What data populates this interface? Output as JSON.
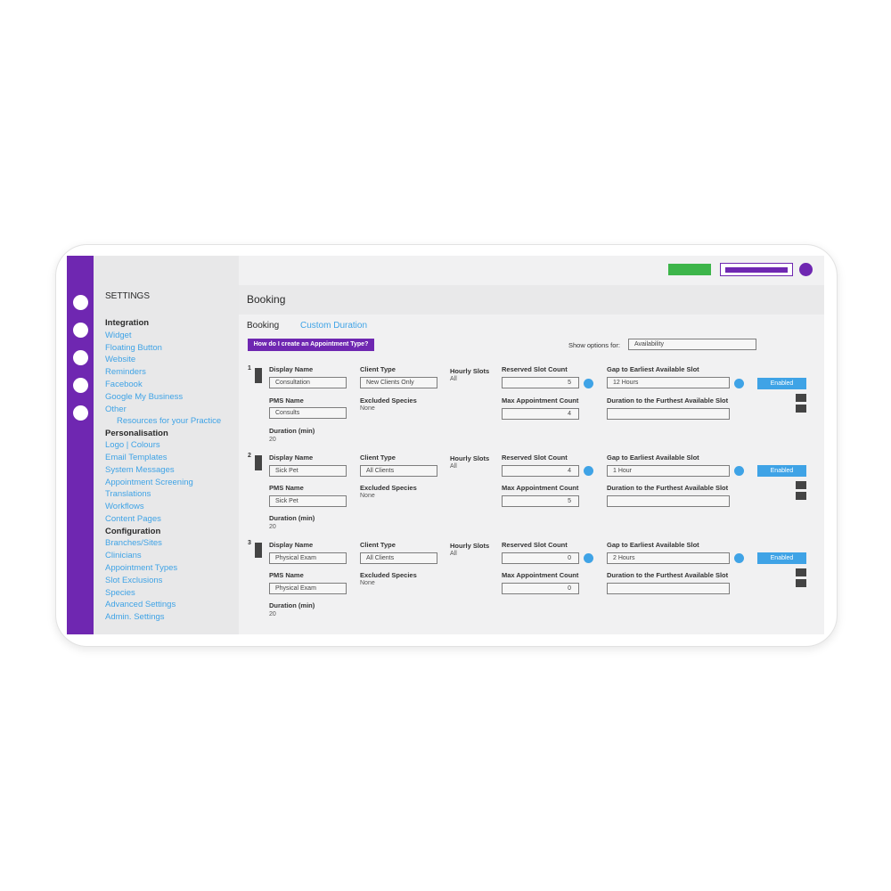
{
  "colors": {
    "accent": "#6f27b1",
    "link": "#3fa3e6",
    "red": "#c8242a",
    "green": "#3db54a",
    "panel": "#f1f1f2",
    "sidebar": "#e8e8e9"
  },
  "topbar": {
    "buttons": [
      "purple-block",
      "red-block",
      "green-block",
      "outlined-purple-block"
    ],
    "avatar": "avatar-circle"
  },
  "sidebar": {
    "title": "SETTINGS",
    "sections": [
      {
        "heading": "Integration",
        "items": [
          "Widget",
          "Floating Button",
          "Website",
          "Reminders",
          "Facebook",
          "Google My Business",
          "Other",
          "Resources for your Practice"
        ]
      },
      {
        "heading": "Personalisation",
        "items": [
          "Logo | Colours",
          "Email Templates",
          "System Messages",
          "Appointment Screening",
          "Translations",
          "Workflows",
          "Content Pages"
        ]
      },
      {
        "heading": "Configuration",
        "items": [
          "Branches/Sites",
          "Clinicians",
          "Appointment Types",
          "Slot Exclusions",
          "Species",
          "Advanced Settings",
          "Admin. Settings"
        ]
      }
    ]
  },
  "main": {
    "title": "Booking",
    "tabs": [
      "Booking",
      "Custom Duration"
    ],
    "help_button": "How do I create an Appointment Type?",
    "show_options_label": "Show options for:",
    "show_options_value": "Availability"
  },
  "labels": {
    "display_name": "Display Name",
    "pms_name": "PMS Name",
    "duration": "Duration (min)",
    "client_type": "Client Type",
    "excluded_species": "Excluded Species",
    "hourly_slots": "Hourly Slots",
    "reserved_slot_count": "Reserved Slot Count",
    "max_appointment_count": "Max Appointment Count",
    "gap_earliest": "Gap to Earliest Available Slot",
    "duration_furthest": "Duration to the Furthest Available Slot"
  },
  "rows": [
    {
      "index": "1",
      "display_name": "Consultation",
      "pms_name": "Consults",
      "duration": "20",
      "client_type": "New Clients Only",
      "excluded_species": "None",
      "hourly_slots": "All",
      "reserved_slot_count": "5",
      "max_appointment_count": "4",
      "gap_earliest": "12 Hours",
      "duration_furthest": "",
      "status": "Enabled"
    },
    {
      "index": "2",
      "display_name": "Sick Pet",
      "pms_name": "Sick Pet",
      "duration": "20",
      "client_type": "All Clients",
      "excluded_species": "None",
      "hourly_slots": "All",
      "reserved_slot_count": "4",
      "max_appointment_count": "5",
      "gap_earliest": "1 Hour",
      "duration_furthest": "",
      "status": "Enabled"
    },
    {
      "index": "3",
      "display_name": "Physical Exam",
      "pms_name": "Physical Exam",
      "duration": "20",
      "client_type": "All Clients",
      "excluded_species": "None",
      "hourly_slots": "All",
      "reserved_slot_count": "0",
      "max_appointment_count": "0",
      "gap_earliest": "2 Hours",
      "duration_furthest": "",
      "status": "Enabled"
    }
  ]
}
